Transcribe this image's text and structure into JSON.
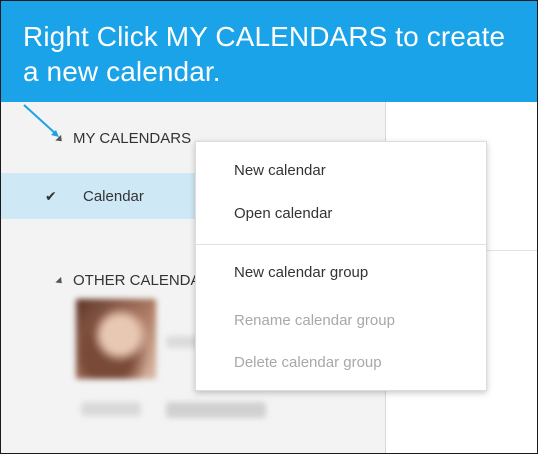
{
  "banner": {
    "line1": "Right Click MY CALENDARS to create",
    "line2": "a new calendar."
  },
  "sidebar": {
    "my_calendars_label": "MY CALENDARS",
    "calendar_item": {
      "check_icon": "check-icon",
      "label": "Calendar"
    },
    "other_calendars_label": "OTHER CALENDARS"
  },
  "context_menu": {
    "items": [
      {
        "label": "New calendar",
        "enabled": true
      },
      {
        "label": "Open calendar",
        "enabled": true
      },
      {
        "label": "New calendar group",
        "enabled": true
      },
      {
        "label": "Rename calendar group",
        "enabled": false
      },
      {
        "label": "Delete calendar group",
        "enabled": false
      }
    ]
  },
  "colors": {
    "banner": "#1aa3e8",
    "selected_item": "#cfe8f6",
    "sidebar": "#f3f3f3",
    "disabled_text": "#a8a8a8",
    "pointer": "#1aa3e8"
  }
}
